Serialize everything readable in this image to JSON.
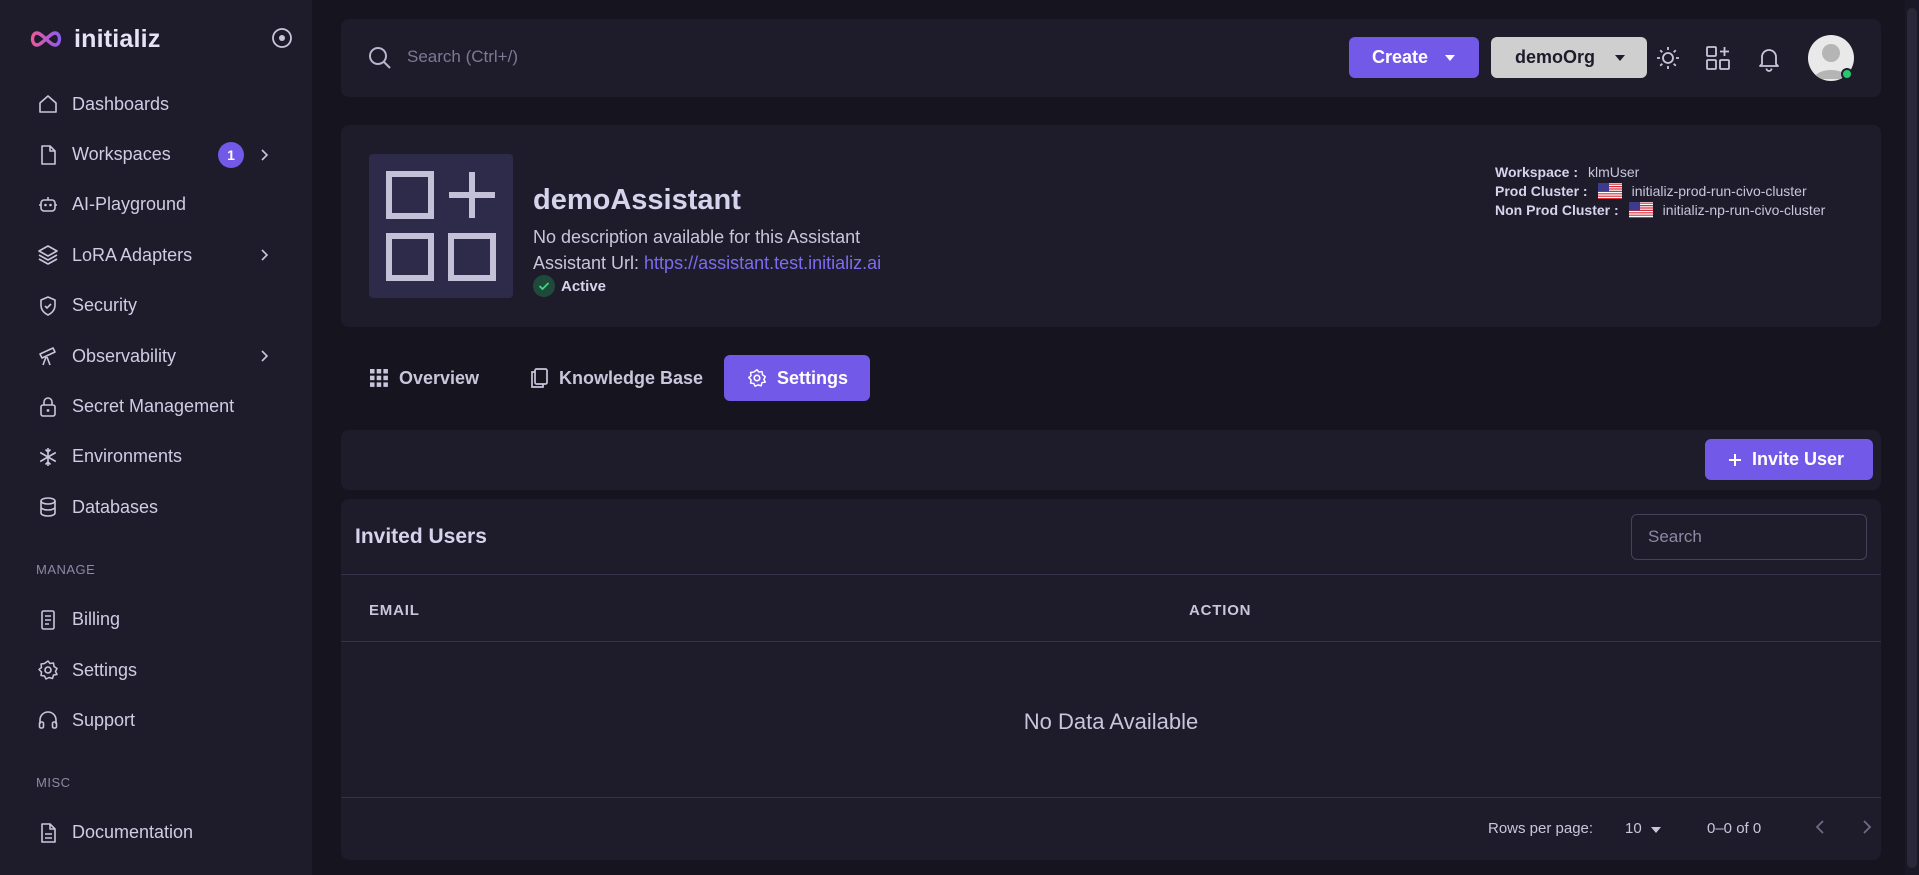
{
  "brand": {
    "name": "initializ"
  },
  "sidebar": {
    "items": [
      {
        "label": "Dashboards"
      },
      {
        "label": "Workspaces",
        "badge": "1"
      },
      {
        "label": "AI-Playground"
      },
      {
        "label": "LoRA Adapters"
      },
      {
        "label": "Security"
      },
      {
        "label": "Observability"
      },
      {
        "label": "Secret Management"
      },
      {
        "label": "Environments"
      },
      {
        "label": "Databases"
      }
    ],
    "manage_header": "MANAGE",
    "manage_items": [
      {
        "label": "Billing"
      },
      {
        "label": "Settings"
      },
      {
        "label": "Support"
      }
    ],
    "misc_header": "MISC",
    "misc_items": [
      {
        "label": "Documentation"
      }
    ]
  },
  "topbar": {
    "search_placeholder": "Search (Ctrl+/)",
    "create_label": "Create",
    "org_label": "demoOrg"
  },
  "assistant": {
    "name": "demoAssistant",
    "description": "No description available for this Assistant",
    "url_label": "Assistant Url:",
    "url": "https://assistant.test.initializ.ai",
    "status": "Active",
    "workspace_label": "Workspace :",
    "workspace": "klmUser",
    "prod_label": "Prod Cluster :",
    "prod_cluster": "initializ-prod-run-civo-cluster",
    "nonprod_label": "Non Prod Cluster :",
    "nonprod_cluster": "initializ-np-run-civo-cluster"
  },
  "tabs": [
    {
      "label": "Overview"
    },
    {
      "label": "Knowledge Base"
    },
    {
      "label": "Settings",
      "active": true
    }
  ],
  "toolbar": {
    "invite_label": "Invite User"
  },
  "table": {
    "title": "Invited Users",
    "search_placeholder": "Search",
    "columns": [
      "EMAIL",
      "ACTION"
    ],
    "empty_text": "No Data Available",
    "rows_per_page_label": "Rows per page:",
    "rows_per_page": "10",
    "range": "0–0 of 0"
  },
  "colors": {
    "accent": "#7259e8",
    "sidebar_bg": "#1e1c2b",
    "page_bg": "#16141f",
    "status_ok": "#28c76f"
  }
}
